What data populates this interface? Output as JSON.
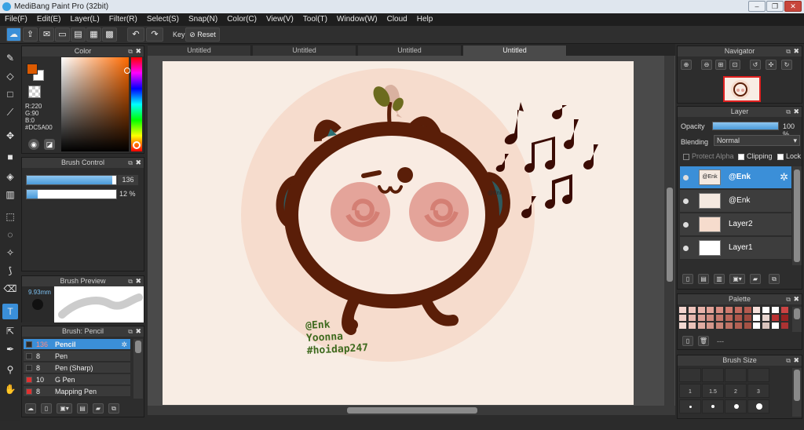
{
  "window": {
    "title": "MediBang Paint Pro (32bit)",
    "min": "–",
    "max": "❐",
    "close": "✕"
  },
  "menu": [
    "File(F)",
    "Edit(E)",
    "Layer(L)",
    "Filter(R)",
    "Select(S)",
    "Snap(N)",
    "Color(C)",
    "View(V)",
    "Tool(T)",
    "Window(W)",
    "Cloud",
    "Help"
  ],
  "toolbar": {
    "key_label": "Key",
    "reset_label": "Reset"
  },
  "color_panel": {
    "title": "Color",
    "r": "R:220",
    "g": "G:90",
    "b": "B:0",
    "hex": "#DC5A00",
    "foreground": "#dc5a00",
    "background": "#ffffff"
  },
  "brush_control": {
    "title": "Brush Control",
    "size": "136",
    "opacity": "12 %",
    "size_fraction": 0.96,
    "opacity_fraction": 0.12
  },
  "brush_preview": {
    "title": "Brush Preview",
    "size_text": "9.93mm"
  },
  "brush_panel": {
    "title": "Brush: Pencil",
    "items": [
      {
        "size": "136",
        "name": "Pencil",
        "swatch": "#2a2a2a"
      },
      {
        "size": "8",
        "name": "Pen",
        "swatch": "#2a2a2a"
      },
      {
        "size": "8",
        "name": "Pen (Sharp)",
        "swatch": "#2a2a2a"
      },
      {
        "size": "10",
        "name": "G Pen",
        "swatch": "#e03030"
      },
      {
        "size": "8",
        "name": "Mapping Pen",
        "swatch": "#e03030"
      }
    ]
  },
  "tabs": [
    "Untitled",
    "Untitled",
    "Untitled",
    "Untitled"
  ],
  "canvas": {
    "signature_line1": "@Enk",
    "signature_line2": "Yoonna",
    "signature_line3": "#hoidap247"
  },
  "navigator": {
    "title": "Navigator"
  },
  "layer_panel": {
    "title": "Layer",
    "opacity_label": "Opacity",
    "opacity_value": "100 %",
    "opacity_fraction": 1.0,
    "blending_label": "Blending",
    "blending_value": "Normal",
    "protect_alpha": "Protect Alpha",
    "clipping": "Clipping",
    "lock": "Lock",
    "layers": [
      {
        "name": "@Enk",
        "thumb_text": "@Enk"
      },
      {
        "name": "@Enk",
        "thumb_text": ""
      },
      {
        "name": "Layer2",
        "thumb_text": ""
      },
      {
        "name": "Layer1",
        "thumb_text": ""
      }
    ]
  },
  "palette": {
    "title": "Palette",
    "extra": "---"
  },
  "brush_size_panel": {
    "title": "Brush Size",
    "sizes": [
      "1",
      "1.5",
      "2",
      "3"
    ]
  }
}
